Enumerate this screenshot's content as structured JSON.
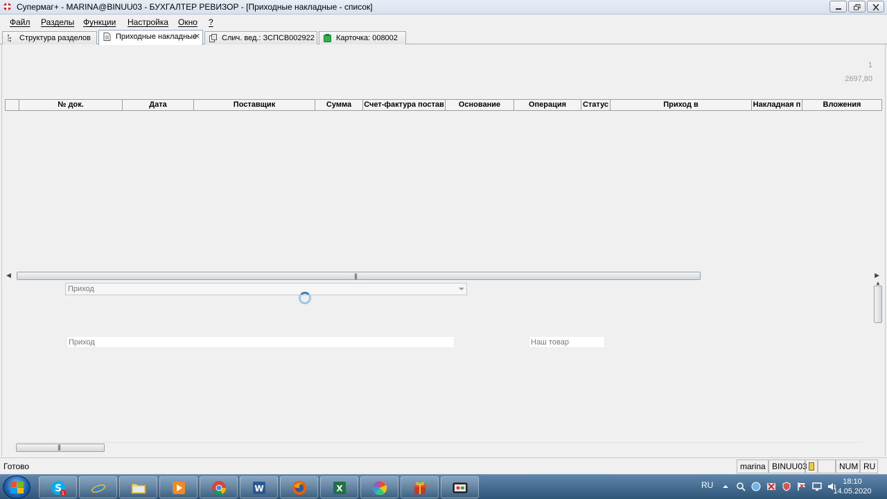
{
  "window": {
    "title": "Супермаг+ - MARINA@BINUU03 - БУХГАЛТЕР РЕВИЗОР  - [Приходные накладные - список]"
  },
  "menu": [
    "Файл",
    "Разделы",
    "Функции",
    "Настройка",
    "Окно",
    "?"
  ],
  "tabs": [
    {
      "label": "Структура разделов",
      "icon": "tree-icon"
    },
    {
      "label": "Приходные накладные",
      "icon": "document-icon",
      "active": true
    },
    {
      "label": "Слич. вед.: ЗСПСВ002922",
      "icon": "compare-sheet-icon"
    },
    {
      "label": "Карточка: 008002",
      "icon": "card-icon"
    }
  ],
  "summary": {
    "count": "1",
    "total": "2697,80"
  },
  "grid": {
    "columns": [
      "№ док.",
      "Дата",
      "Поставщик",
      "Сумма",
      "Счет-фактура постав",
      "Основание",
      "Операция",
      "Статус",
      "Приход в",
      "Накладная п",
      "Вложения"
    ]
  },
  "details": {
    "operation_select": "Приход",
    "operation_text": "Приход",
    "goods_type": "Наш товар"
  },
  "status": {
    "text": "Готово",
    "user": "marina",
    "host": "BINUU03",
    "num": "NUM",
    "lang": "RU"
  },
  "taskbar": {
    "apps": [
      "skype",
      "internet-explorer",
      "file-explorer",
      "media-player",
      "chrome",
      "word",
      "firefox",
      "excel",
      "photos",
      "gift-app",
      "screen-recorder"
    ],
    "skype_badge": "1",
    "lang": "RU",
    "time": "18:10",
    "date": "14.05.2020"
  },
  "colors": {
    "accent": "#2f7fc1",
    "taskbar": "#3f6a92"
  }
}
